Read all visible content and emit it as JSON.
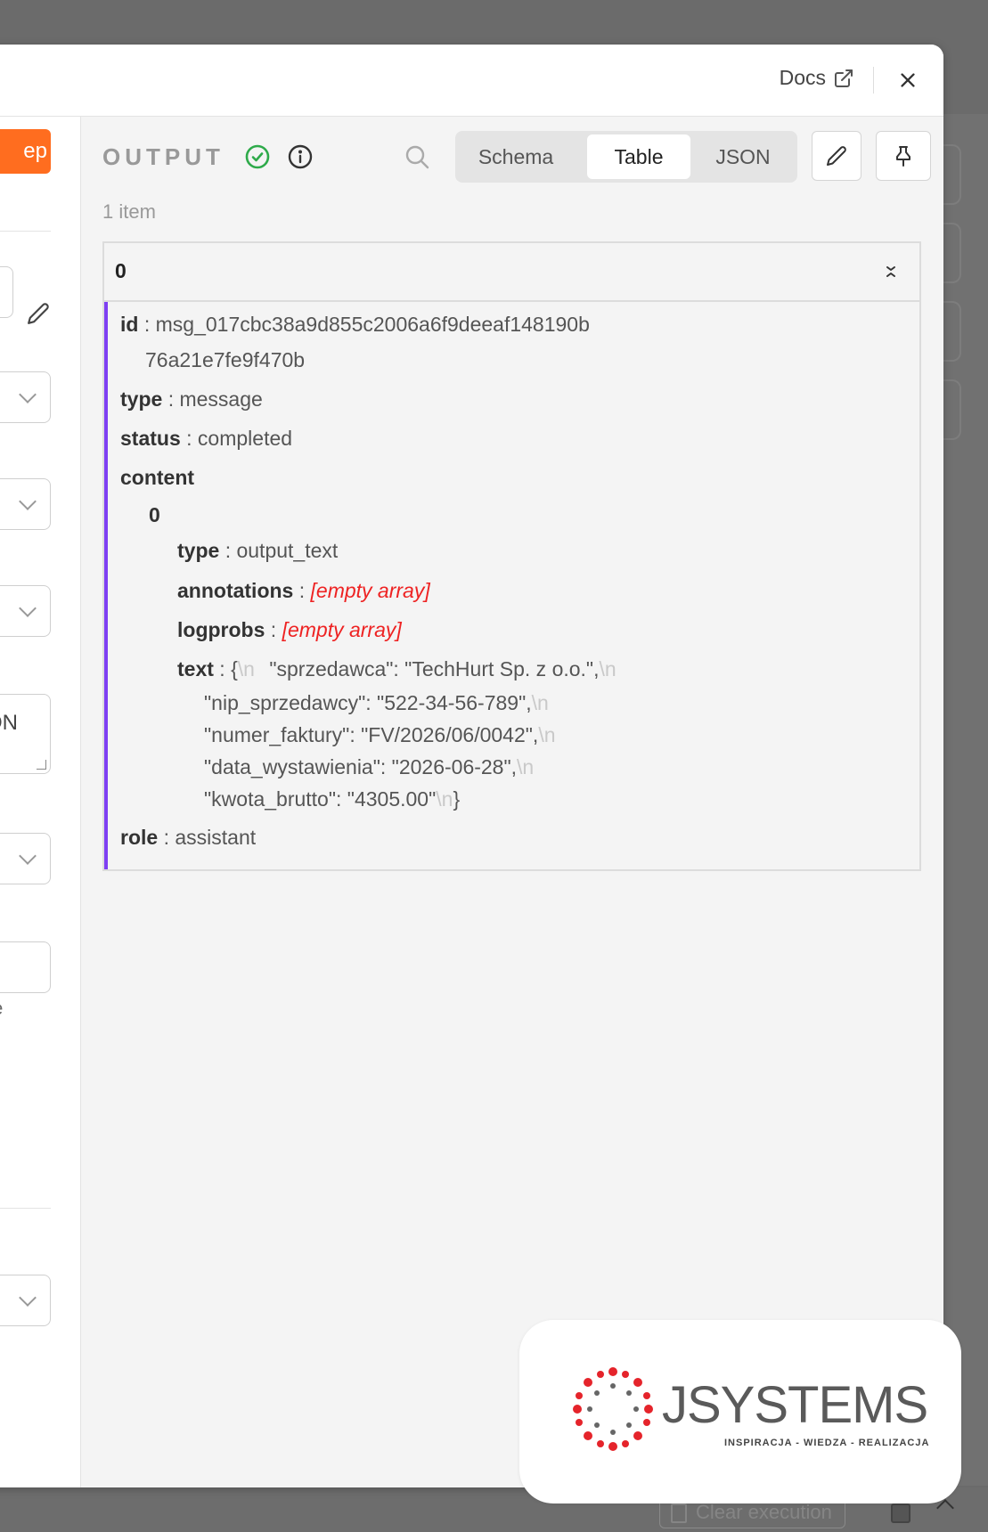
{
  "header": {
    "docs_label": "Docs"
  },
  "input_panel": {
    "step_button_label": "ep",
    "textarea_partial": "ON",
    "helper_partial": "pe"
  },
  "output": {
    "title": "OUTPUT",
    "view_options": [
      "Schema",
      "Table",
      "JSON"
    ],
    "active_view": "Table",
    "item_count": "1 item",
    "item_index": "0",
    "fields": {
      "id_key": "id",
      "id_value_line1": "msg_017cbc38a9d855c2006a6f9deeaf148190b",
      "id_value_line2": "76a21e7fe9f470b",
      "type_key": "type",
      "type_value": "message",
      "status_key": "status",
      "status_value": "completed",
      "content_key": "content",
      "content_index": "0",
      "content_type_key": "type",
      "content_type_value": "output_text",
      "annotations_key": "annotations",
      "annotations_value": "[empty array]",
      "logprobs_key": "logprobs",
      "logprobs_value": "[empty array]",
      "text_key": "text",
      "text_lines": [
        "\"sprzedawca\": \"TechHurt Sp. z o.o.\",",
        "\"nip_sprzedawcy\": \"522-34-56-789\",",
        "\"numer_faktury\": \"FV/2026/06/0042\",",
        "\"data_wystawienia\": \"2026-06-28\",",
        "\"kwota_brutto\": \"4305.00\""
      ],
      "newline_marker": "\\n",
      "open_brace": "{",
      "close_brace": "}",
      "role_key": "role",
      "role_value": "assistant"
    }
  },
  "logo": {
    "name": "JSystems",
    "wordmark": "JSYSTEMS",
    "tagline": "INSPIRACJA - WIEDZA - REALIZACJA"
  },
  "bottom_bar": {
    "clear_execution_label": "Clear execution"
  },
  "colors": {
    "accent_orange": "#ff6d1f",
    "item_border_purple": "#7e3ff2",
    "success_green": "#2eaa4a",
    "empty_red": "#e22222"
  }
}
